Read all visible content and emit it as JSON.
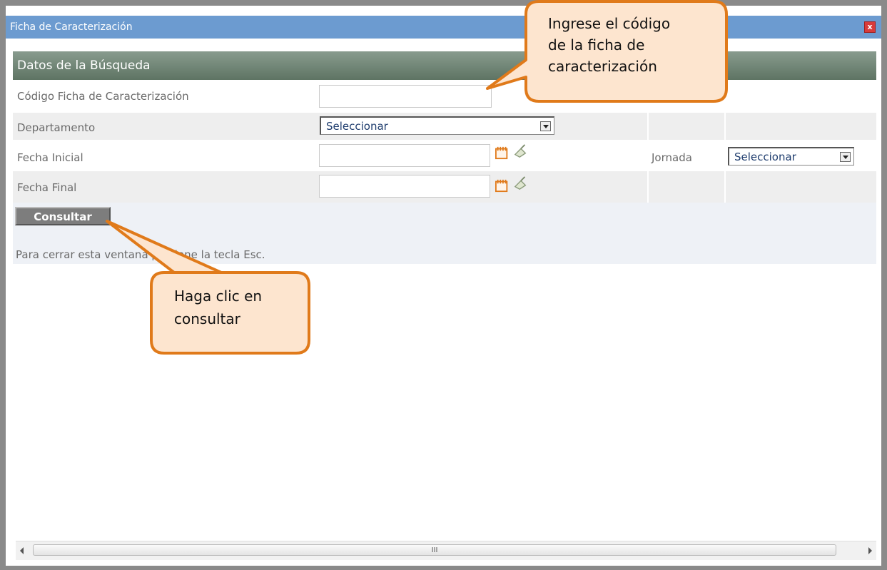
{
  "window": {
    "title": "Ficha de Caracterización",
    "close_label": "x"
  },
  "section": {
    "title": "Datos de la Búsqueda"
  },
  "form": {
    "codigo_label": "Código Ficha de Caracterización",
    "codigo_value": "",
    "departamento_label": "Departamento",
    "departamento_value": "Seleccionar",
    "fecha_inicial_label": "Fecha Inicial",
    "fecha_inicial_value": "",
    "jornada_label": "Jornada",
    "jornada_value": "Seleccionar",
    "fecha_final_label": "Fecha Final",
    "fecha_final_value": ""
  },
  "actions": {
    "consultar_label": "Consultar"
  },
  "hint": {
    "text": "Para cerrar esta ventana presione la tecla Esc."
  },
  "callouts": {
    "top": {
      "line1": "Ingrese el código",
      "line2": "de la ficha de",
      "line3": "caracterización"
    },
    "bottom": {
      "line1": "Haga clic en",
      "line2": "consultar"
    }
  },
  "scrollbar": {
    "grip": "III"
  },
  "colors": {
    "titlebar": "#6c9bd0",
    "section": "#6f8573",
    "callout_fill": "#fde5cf",
    "callout_border": "#e07a1a"
  }
}
